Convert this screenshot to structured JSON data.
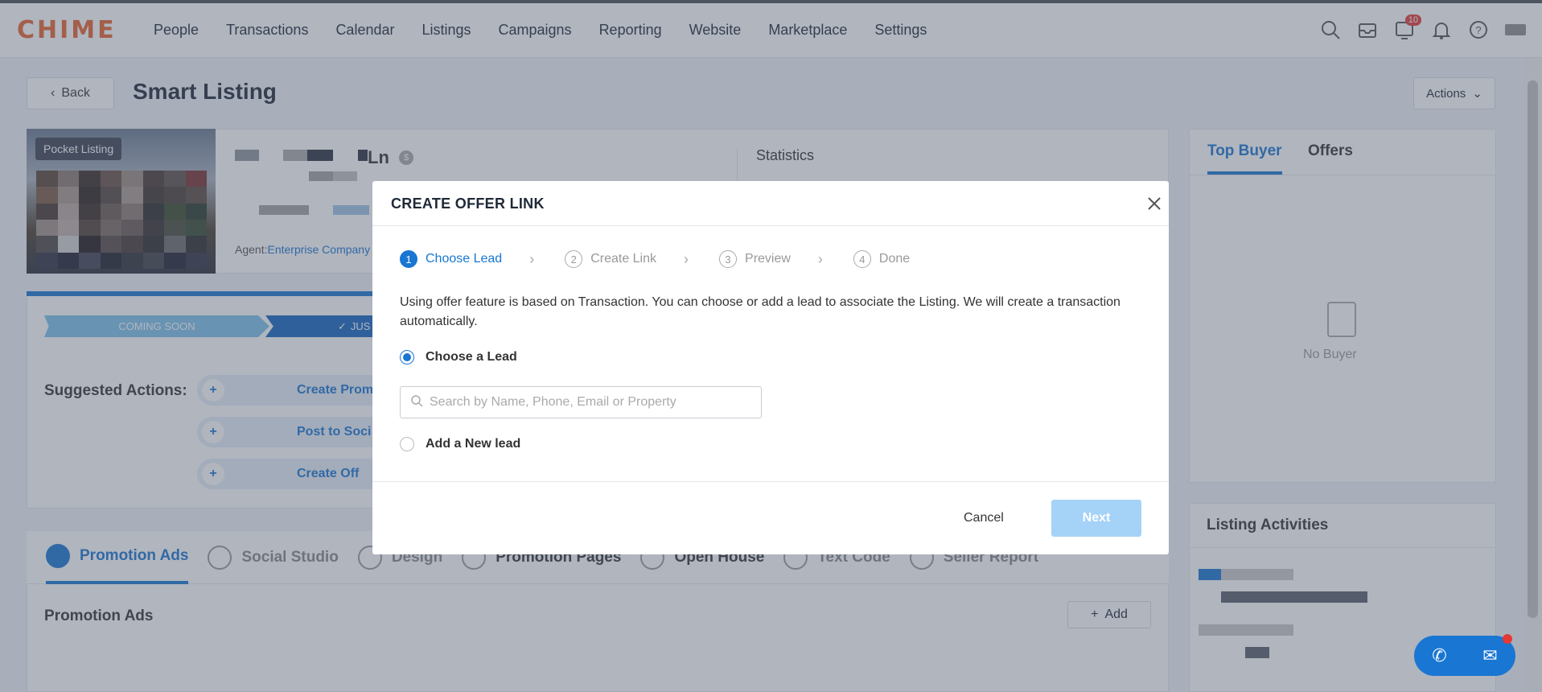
{
  "nav": {
    "logo": "CHIME",
    "items": [
      "People",
      "Transactions",
      "Calendar",
      "Listings",
      "Campaigns",
      "Reporting",
      "Website",
      "Marketplace",
      "Settings"
    ],
    "notification_count": "10"
  },
  "header": {
    "back_label": "Back",
    "title": "Smart Listing",
    "actions_label": "Actions"
  },
  "listing": {
    "tag": "Pocket Listing",
    "address_suffix": "Ln",
    "agent_label": "Agent:",
    "agent_name": "Enterprise Company",
    "statistics_label": "Statistics"
  },
  "status": {
    "coming_soon": "COMING SOON",
    "just": "JUS"
  },
  "suggested": {
    "label": "Suggested Actions:",
    "buttons": [
      "Create Prom",
      "Post to Soci",
      "Create Off"
    ]
  },
  "tabs": [
    "Promotion Ads",
    "Social Studio",
    "Design",
    "Promotion Pages",
    "Open House",
    "Text Code",
    "Seller Report"
  ],
  "promo": {
    "heading": "Promotion Ads",
    "add_label": "Add"
  },
  "right": {
    "tab_top_buyer": "Top Buyer",
    "tab_offers": "Offers",
    "no_buyer": "No Buyer",
    "activities_title": "Listing Activities"
  },
  "modal": {
    "title": "CREATE OFFER LINK",
    "steps": [
      {
        "num": "1",
        "label": "Choose Lead"
      },
      {
        "num": "2",
        "label": "Create Link"
      },
      {
        "num": "3",
        "label": "Preview"
      },
      {
        "num": "4",
        "label": "Done"
      }
    ],
    "description": "Using offer feature is based on Transaction. You can choose or add a lead to associate the Listing. We will create a transaction automatically.",
    "option_choose": "Choose a Lead",
    "option_add": "Add a New lead",
    "search_placeholder": "Search by Name, Phone, Email or Property",
    "cancel_label": "Cancel",
    "next_label": "Next"
  },
  "colors": {
    "accent": "#1976d2",
    "brand": "#e8632b",
    "next_disabled": "#a5d2f7"
  }
}
